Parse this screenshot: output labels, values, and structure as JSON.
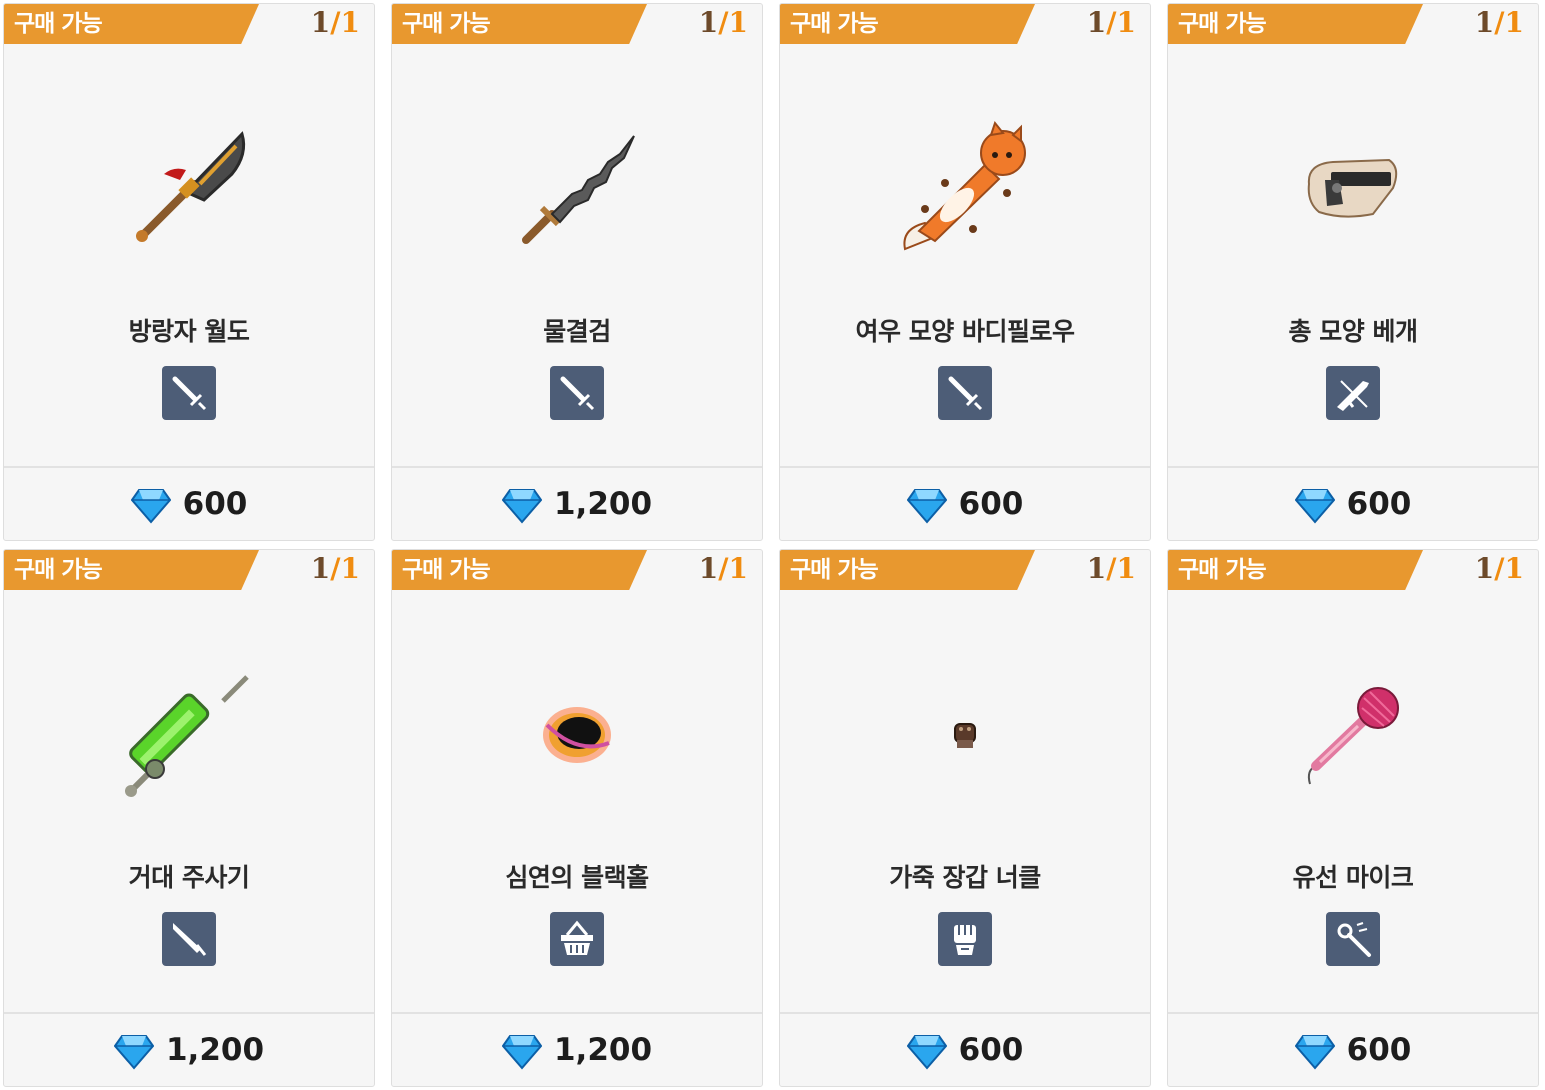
{
  "status_label": "구매 가능",
  "items": [
    {
      "name": "방랑자 월도",
      "count": "1",
      "max": "1",
      "price": "600",
      "type_icon": "sword-icon",
      "art_icon": "glaive-icon"
    },
    {
      "name": "물결검",
      "count": "1",
      "max": "1",
      "price": "1,200",
      "type_icon": "sword-icon",
      "art_icon": "wave-sword-icon"
    },
    {
      "name": "여우 모양 바디필로우",
      "count": "1",
      "max": "1",
      "price": "600",
      "type_icon": "sword-icon",
      "art_icon": "fox-pillow-icon"
    },
    {
      "name": "총 모양 베개",
      "count": "1",
      "max": "1",
      "price": "600",
      "type_icon": "rifle-icon",
      "art_icon": "gun-pillow-icon"
    },
    {
      "name": "거대 주사기",
      "count": "1",
      "max": "1",
      "price": "1,200",
      "type_icon": "blade-icon",
      "art_icon": "syringe-icon"
    },
    {
      "name": "심연의 블랙홀",
      "count": "1",
      "max": "1",
      "price": "1,200",
      "type_icon": "basket-icon",
      "art_icon": "black-hole-icon"
    },
    {
      "name": "가죽 장갑 너클",
      "count": "1",
      "max": "1",
      "price": "600",
      "type_icon": "fist-icon",
      "art_icon": "glove-knuckle-icon"
    },
    {
      "name": "유선 마이크",
      "count": "1",
      "max": "1",
      "price": "600",
      "type_icon": "wand-icon",
      "art_icon": "microphone-icon"
    }
  ],
  "colors": {
    "tag": "#e8982f",
    "type_badge": "#4d5d77",
    "card_bg": "#f6f6f6",
    "gem": "#2aa6ee"
  },
  "currency_icon": "diamond-gem-icon"
}
